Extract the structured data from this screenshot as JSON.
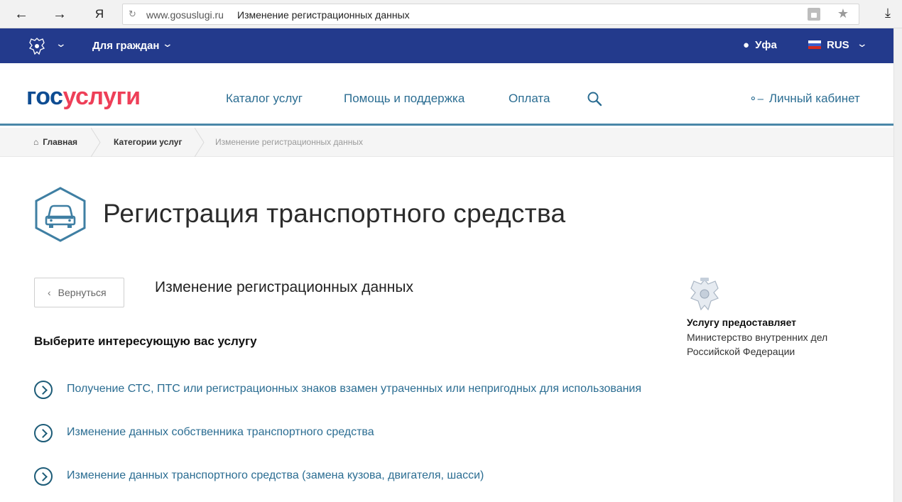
{
  "browser": {
    "address_domain": "www.gosuslugi.ru",
    "address_title": "Изменение регистрационных данных",
    "yandex_glyph": "Я"
  },
  "topbar": {
    "for_citizens": "Для граждан",
    "city": "Уфа",
    "language": "RUS",
    "bg_color": "#233a8c"
  },
  "header": {
    "logo_part1": "гос",
    "logo_part2": "услуги",
    "nav": [
      "Каталог услуг",
      "Помощь и поддержка",
      "Оплата"
    ],
    "cabinet": "Личный кабинет"
  },
  "breadcrumb": [
    "Главная",
    "Категории услуг",
    "Изменение регистрационных данных"
  ],
  "main": {
    "title": "Регистрация транспортного средства",
    "back_label": "Вернуться",
    "subtitle": "Изменение регистрационных данных",
    "choose_label": "Выберите интересующую вас услугу",
    "options": [
      "Получение СТС, ПТС или регистрационных знаков взамен утраченных или непригодных для использования",
      "Изменение данных собственника транспортного средства",
      "Изменение данных транспортного средства (замена кузова, двигателя, шасси)"
    ]
  },
  "provider": {
    "label": "Услугу предоставляет",
    "name": "Министерство внутренних дел Российской Федерации"
  },
  "colors": {
    "link": "#2b6d92",
    "logo_blue": "#0d4c92",
    "logo_red": "#ee3f58"
  }
}
